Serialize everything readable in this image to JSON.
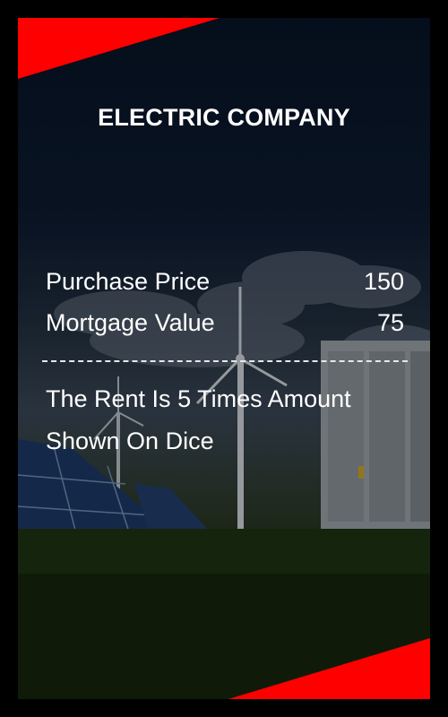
{
  "card": {
    "title": "ELECTRIC COMPANY",
    "purchase_price_label": "Purchase Price",
    "purchase_price_value": "150",
    "mortgage_value_label": "Mortgage Value",
    "mortgage_value_value": "75",
    "rent_text": "The Rent Is 5 Times Amount Shown On Dice"
  },
  "colors": {
    "accent": "#ff0000",
    "frame": "#000000",
    "text": "#ffffff"
  },
  "background_image": "wind-turbines-solar-panels-grass"
}
